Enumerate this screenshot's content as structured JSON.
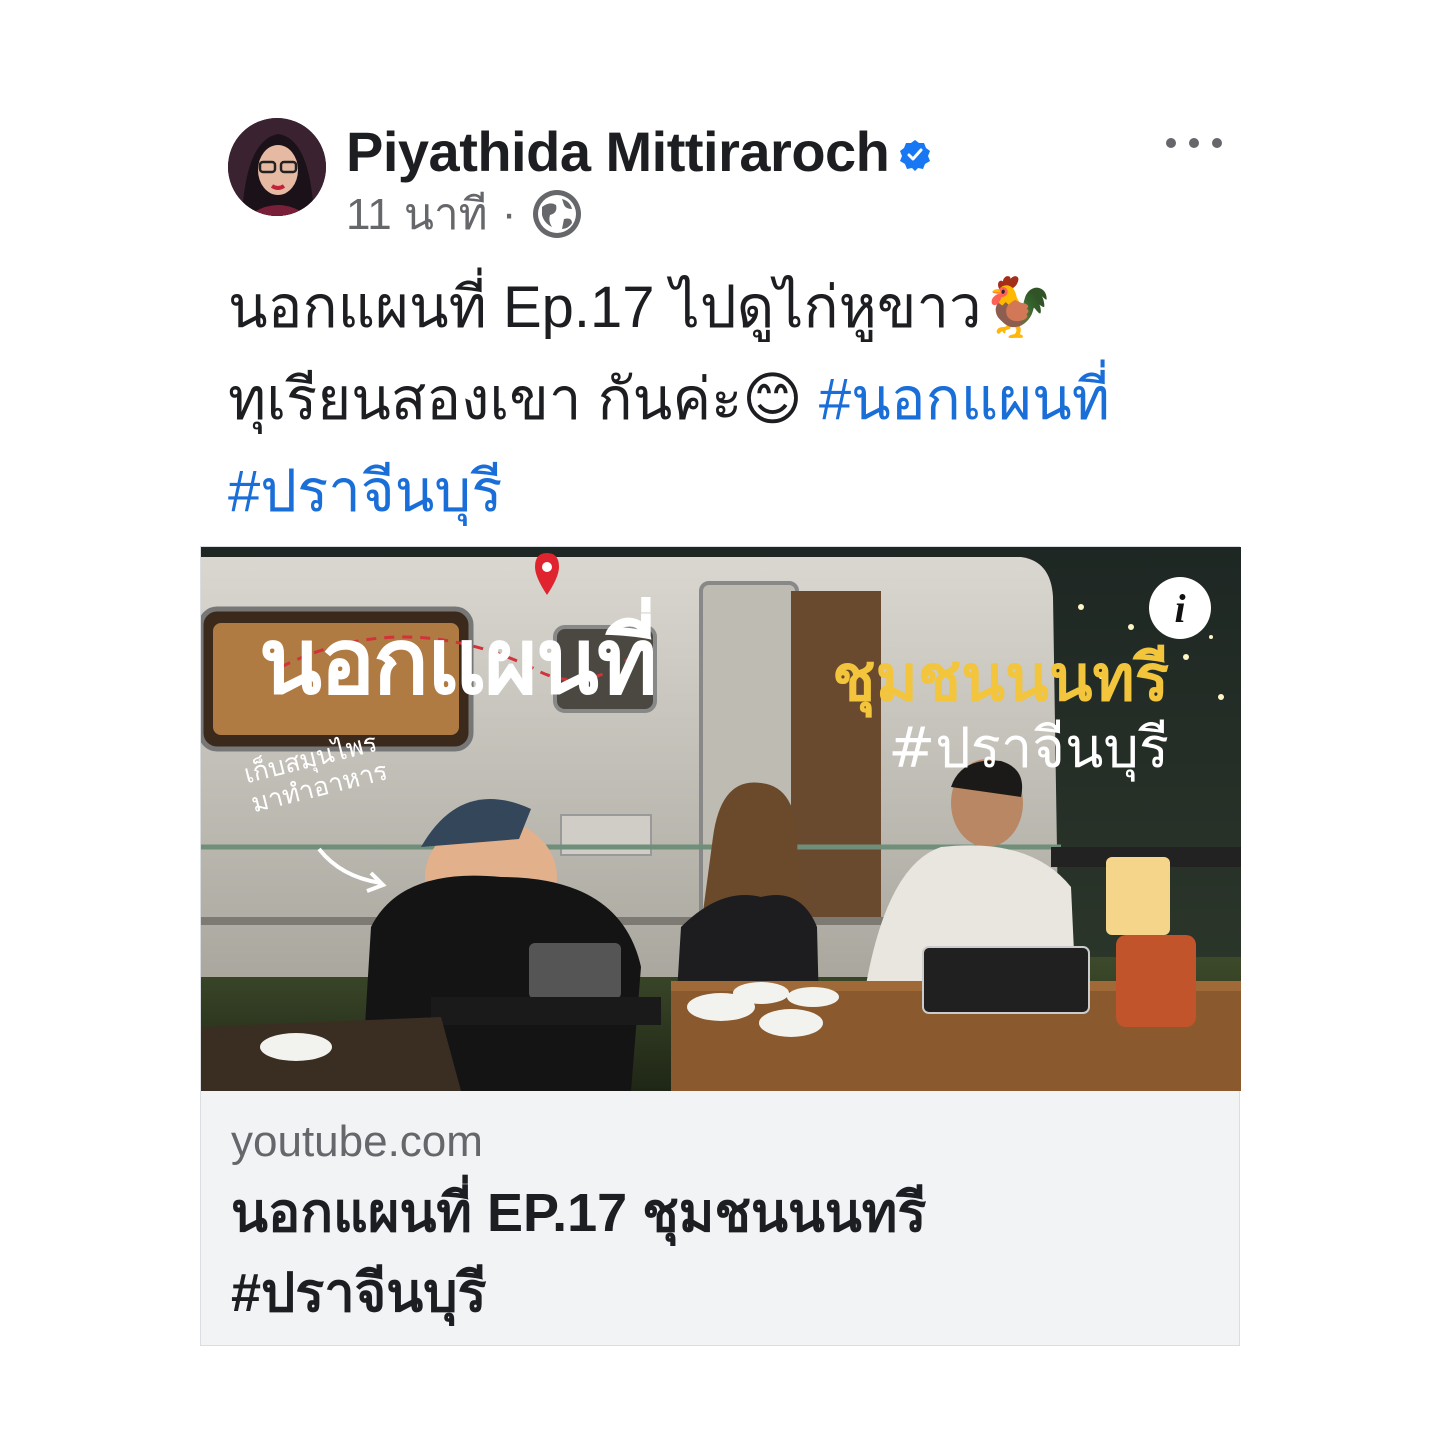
{
  "post": {
    "author_name": "Piyathida Mittiraroch",
    "timestamp": "11 นาที",
    "separator": "·",
    "privacy_icon": "globe-icon",
    "verified_icon": "verified-badge-icon",
    "more_icon": "more-options-icon",
    "caption": {
      "line1": "นอกแผนที่ Ep.17 ไปดูไก่หูขาว🐓",
      "line2_text": "ทุเรียนสองเขา กันค่ะ😊 ",
      "hashtag1": "#นอกแผนที่",
      "hashtag2": "#ปราจีนบุรี"
    }
  },
  "link_preview": {
    "thumbnail": {
      "title": "นอกแผนที่",
      "subtitle": "ชุมชนนนทรี",
      "hashtag": "#ปราจีนบุรี",
      "side_text_line1": "เก็บสมุนไพร",
      "side_text_line2": "มาทำอาหาร",
      "info_label": "i"
    },
    "domain": "youtube.com",
    "title_line1": "นอกแผนที่ EP.17 ชุมชนนนทรี",
    "title_line2": "#ปราจีนบุรี"
  },
  "colors": {
    "hashtag": "#1a6ed8",
    "verified": "#1877f2",
    "subtitle_yellow": "#f2c53d",
    "card_footer_bg": "#f1f3f5"
  }
}
